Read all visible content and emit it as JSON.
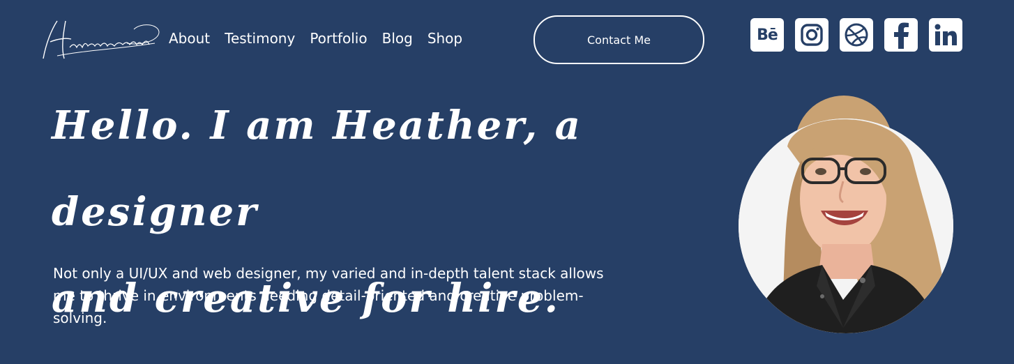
{
  "header": {
    "logo_text": "Heather van der Uys",
    "nav": [
      {
        "label": "About"
      },
      {
        "label": "Testimony"
      },
      {
        "label": "Portfolio"
      },
      {
        "label": "Blog"
      },
      {
        "label": "Shop"
      }
    ],
    "contact_label": "Contact Me",
    "socials": [
      {
        "icon": "behance-icon",
        "glyph": "Bē"
      },
      {
        "icon": "instagram-icon"
      },
      {
        "icon": "dribbble-icon"
      },
      {
        "icon": "facebook-icon"
      },
      {
        "icon": "linkedin-icon"
      }
    ]
  },
  "hero": {
    "heading_line1": "Hello. I am Heather, a designer",
    "heading_line2": "and creative for hire.",
    "body": "Not only a UI/UX and web designer, my varied and in-depth talent stack allows me to thrive in environments needing detail-oriented and creative problem-solving."
  },
  "colors": {
    "background": "#263f66",
    "foreground": "#ffffff",
    "icon_tile": "#ffffff"
  }
}
